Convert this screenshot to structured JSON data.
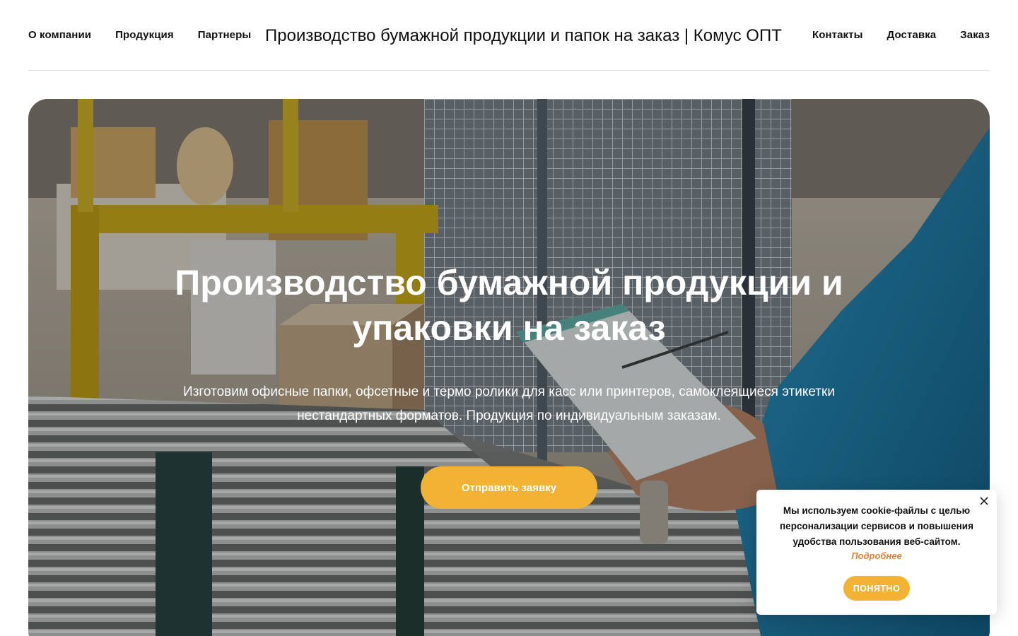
{
  "header": {
    "nav_left": [
      "О компании",
      "Продукция",
      "Партнеры"
    ],
    "site_title": "Производство бумажной продукции и папок на заказ | Комус ОПТ",
    "nav_right": [
      "Контакты",
      "Доставка",
      "Заказ"
    ]
  },
  "hero": {
    "title": "Производство бумажной продукции и упаковки на заказ",
    "text": "Изготовим офисные папки, офсетные и термо ролики для касс или принтеров, самоклеящиеся этикетки нестандартных форматов. Продукция по индивидуальным заказам.",
    "cta_label": "Отправить заявку",
    "image": "warehouse-conveyor-photo"
  },
  "cookie": {
    "text": "Мы используем cookie-файлы с целью персонализации сервисов и повышения удобства пользования веб-сайтом.",
    "more_label": "Подробнее",
    "ok_label": "ПОНЯТНО",
    "close_icon": "close-icon"
  },
  "colors": {
    "accent": "#f2b233",
    "link_orange": "#e4833a",
    "divider": "#d9d9d9"
  }
}
